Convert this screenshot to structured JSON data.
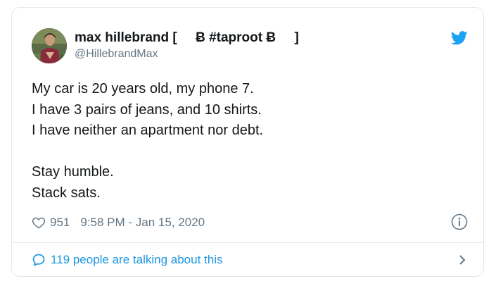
{
  "tweet": {
    "display_name": "max hillebrand [     Ƀ #taproot Ƀ     ]",
    "handle": "@HillebrandMax",
    "lines": [
      "My car is 20 years old, my phone 7.",
      "I have 3 pairs of jeans, and 10 shirts.",
      "I have neither an apartment nor debt.",
      "",
      "Stay humble.",
      "Stack sats."
    ],
    "likes": "951",
    "timestamp": "9:58 PM - Jan 15, 2020",
    "conversation": "119 people are talking about this"
  },
  "colors": {
    "accent": "#1da1f2",
    "link": "#1b95e0",
    "secondary_text": "#657786",
    "border": "#e1e8ed"
  },
  "icons": {
    "brand": "twitter-bird-icon",
    "like": "heart-icon",
    "info": "info-icon",
    "conversation": "speech-bubble-icon",
    "more": "chevron-right-icon"
  }
}
